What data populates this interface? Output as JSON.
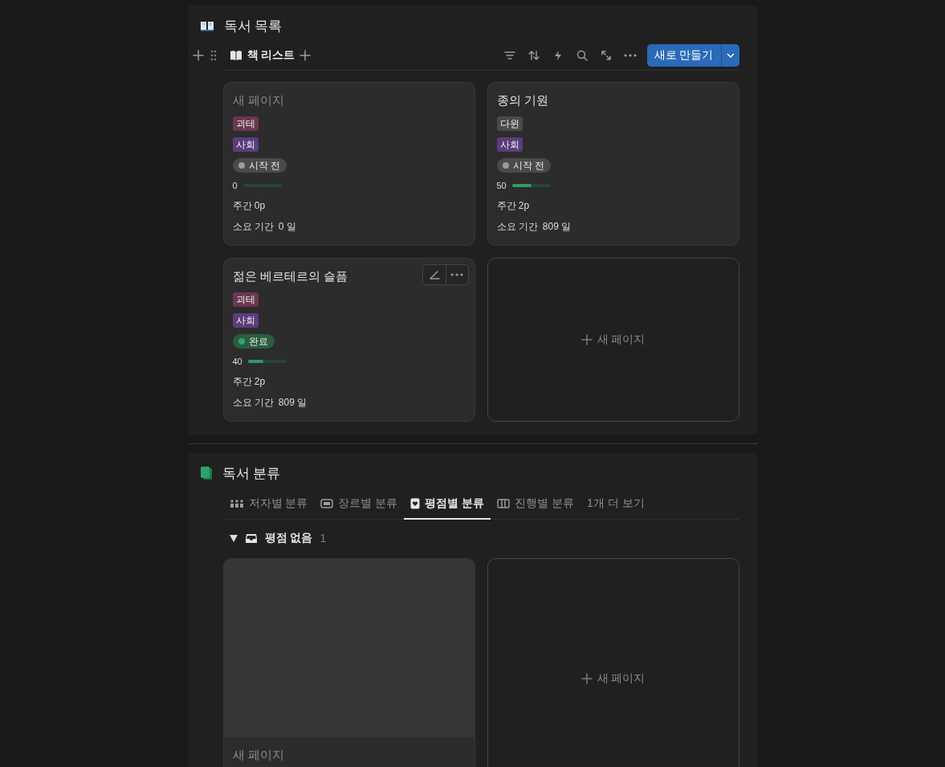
{
  "sections": [
    {
      "kind": "board",
      "title": "독서 목록",
      "view_tab": "책 리스트",
      "new_button": "새로 만들기",
      "cards": [
        {
          "kind": "page",
          "title": "새 페이지",
          "untitled": true,
          "tags": [
            {
              "label": "괴테",
              "color": "#6b3650"
            },
            {
              "label": "사회",
              "color": "#5a3d7a"
            }
          ],
          "status": {
            "label": "시작 전",
            "kind": "not_started"
          },
          "progress": {
            "value": "0",
            "level": 0
          },
          "weekly": "주간 0p",
          "duration_label": "소요 기간",
          "duration_value": "0 일"
        },
        {
          "kind": "page",
          "title": "종의 기원",
          "untitled": false,
          "tags": [
            {
              "label": "다윈",
              "color": "#4a4a4a"
            },
            {
              "label": "사회",
              "color": "#5a3d7a"
            }
          ],
          "status": {
            "label": "시작 전",
            "kind": "not_started"
          },
          "progress": {
            "value": "50",
            "level": 0.5
          },
          "weekly": "주간 2p",
          "duration_label": "소요 기간",
          "duration_value": "809 일"
        },
        {
          "kind": "page",
          "title": "젊은 베르테르의 슬픔",
          "untitled": false,
          "hovered": true,
          "tags": [
            {
              "label": "괴테",
              "color": "#6b3650"
            },
            {
              "label": "사회",
              "color": "#5a3d7a"
            }
          ],
          "status": {
            "label": "완료",
            "kind": "done"
          },
          "progress": {
            "value": "40",
            "level": 0.4
          },
          "weekly": "주간 2p",
          "duration_label": "소요 기간",
          "duration_value": "809 일"
        },
        {
          "kind": "add",
          "label": "새 페이지"
        }
      ]
    },
    {
      "kind": "grouped",
      "title": "독서 분류",
      "tabs": [
        {
          "label": "저자별 분류",
          "selected": false
        },
        {
          "label": "장르별 분류",
          "selected": false
        },
        {
          "label": "평점별 분류",
          "selected": true
        },
        {
          "label": "진행별 분류",
          "selected": false
        },
        {
          "label": "1개 더 보기",
          "selected": false
        }
      ],
      "group": {
        "label": "평점 없음",
        "count": "1",
        "expanded": true
      },
      "cards": [
        {
          "kind": "page",
          "title": "새 페이지",
          "untitled": true,
          "cover": true
        },
        {
          "kind": "add",
          "label": "새 페이지"
        }
      ]
    }
  ]
}
